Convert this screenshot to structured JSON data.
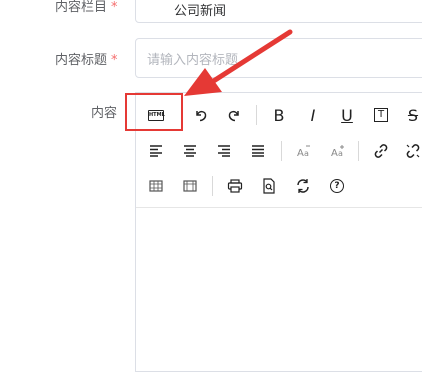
{
  "form": {
    "category": {
      "label": "内容栏目",
      "required_mark": "*",
      "value": "公司新闻"
    },
    "title": {
      "label": "内容标题",
      "required_mark": "*",
      "placeholder": "请输入内容标题"
    },
    "content": {
      "label": "内容"
    }
  },
  "toolbar": {
    "html_badge": "HTML",
    "bold": "B",
    "italic": "I",
    "underline": "U",
    "text_box": "T",
    "strike": "S",
    "help": "?"
  },
  "colors": {
    "highlight": "#e53935",
    "required": "#f56c6c",
    "border": "#dcdfe6"
  }
}
